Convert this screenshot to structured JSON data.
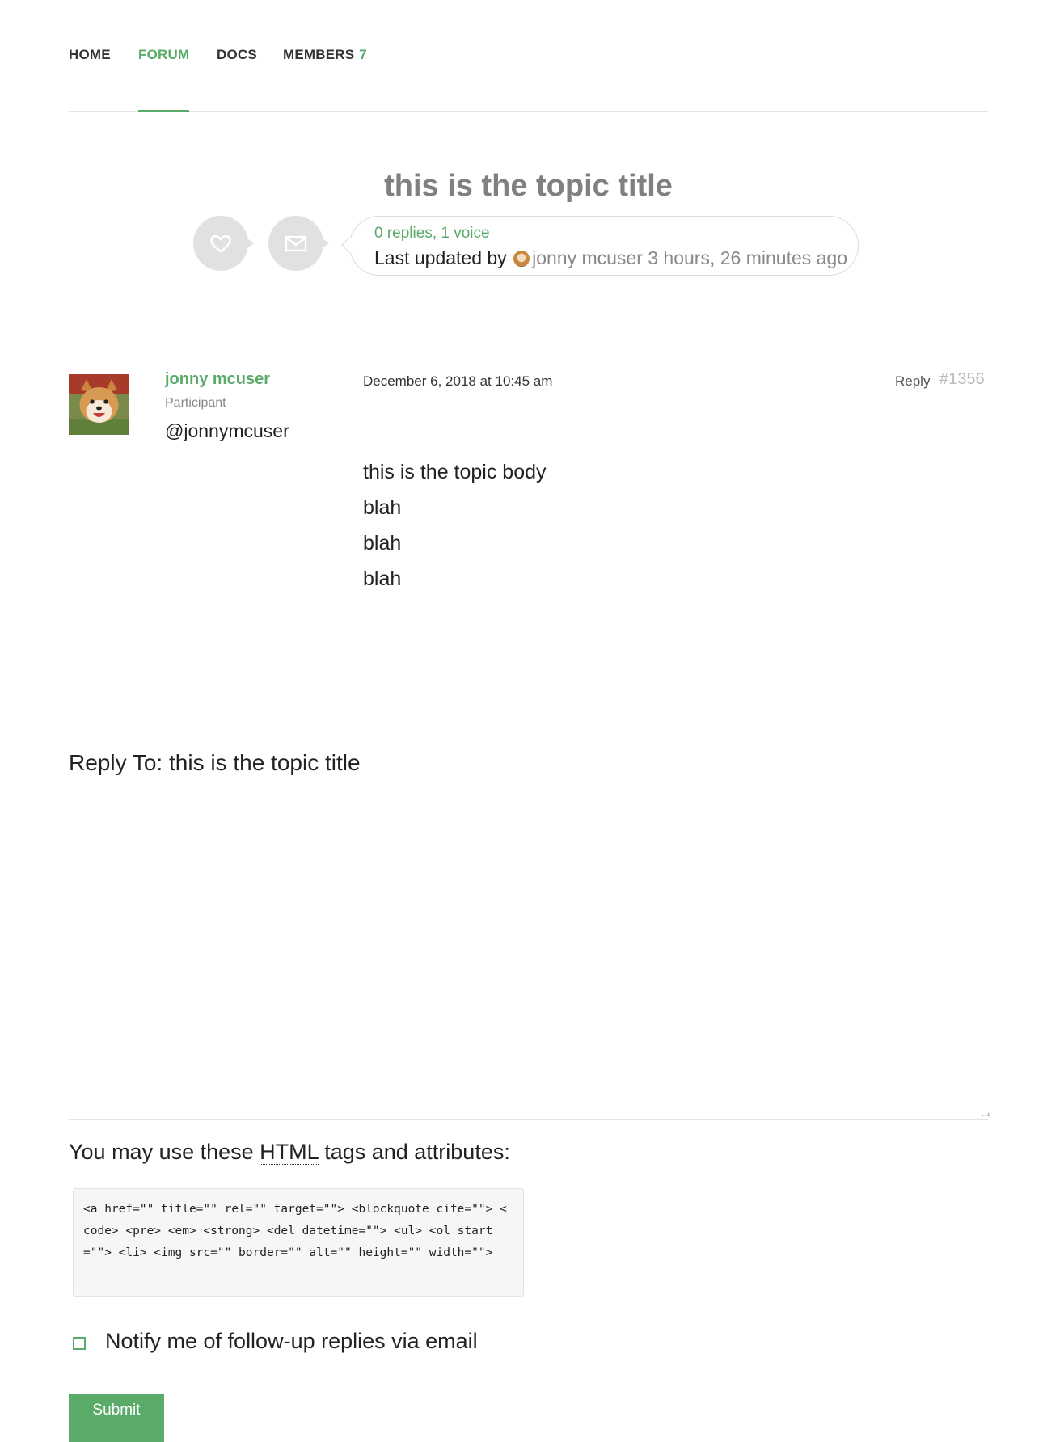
{
  "nav": {
    "items": [
      {
        "label": "HOME"
      },
      {
        "label": "FORUM"
      },
      {
        "label": "DOCS"
      },
      {
        "label": "MEMBERS",
        "count": "7"
      }
    ]
  },
  "topic": {
    "title": "this is the topic title",
    "stats": "0 replies, 1 voice",
    "last_updated_prefix": "Last updated by",
    "last_updated_author": "jonny mcuser",
    "last_updated_time": "3 hours, 26 minutes ago",
    "icons": [
      "heart-icon",
      "envelope-icon"
    ]
  },
  "post": {
    "author_name": "jonny mcuser",
    "author_role": "Participant",
    "author_handle": "@jonnymcuser",
    "date": "December 6, 2018 at 10:45 am",
    "reply_label": "Reply",
    "post_id": "#1356",
    "body": [
      "this is the topic body",
      "blah",
      "blah",
      "blah"
    ]
  },
  "reply_form": {
    "heading": "Reply To: this is the topic title",
    "allowed_prefix": "You may use these",
    "allowed_abbr": "HTML",
    "allowed_suffix": "tags and attributes:",
    "allowed_tags": "<a href=\"\" title=\"\" rel=\"\" target=\"\"> <blockquote cite=\"\"> <code> <pre> <em> <strong> <del datetime=\"\"> <ul> <ol start=\"\"> <li> <img src=\"\" border=\"\" alt=\"\" height=\"\" width=\"\">",
    "notify_label": "Notify me of follow-up replies via email",
    "notify_checked": false,
    "submit_label": "Submit"
  },
  "colors": {
    "accent": "#5aaa6a",
    "title_gray": "#808080",
    "circle_bg": "#e1e1e1"
  }
}
